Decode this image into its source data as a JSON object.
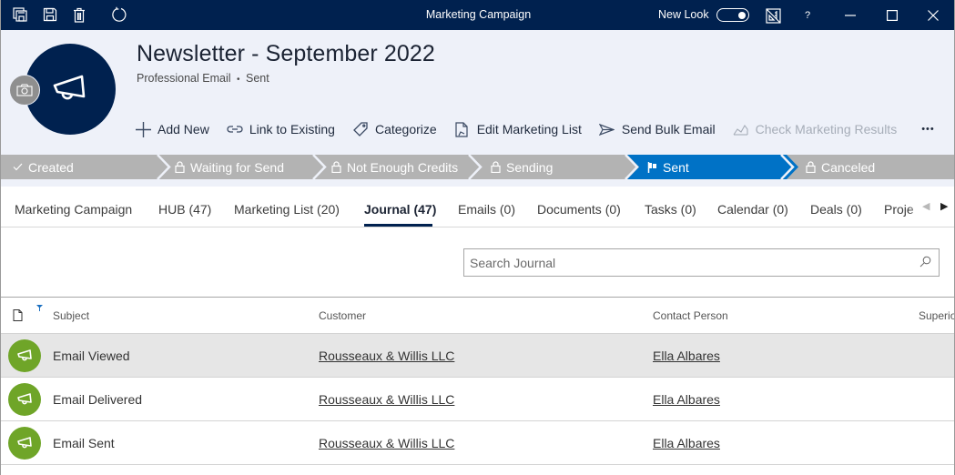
{
  "window": {
    "title": "Marketing Campaign",
    "new_look_label": "New Look",
    "new_look_on": true,
    "help_label": "?"
  },
  "titlebar_icons": [
    "save-all-icon",
    "save-icon",
    "delete-icon",
    "refresh-icon"
  ],
  "record": {
    "title": "Newsletter - September 2022",
    "subtitle_type": "Professional Email",
    "subtitle_sep": "•",
    "subtitle_status": "Sent"
  },
  "commands": [
    {
      "label": "Add New",
      "icon": "plus-icon",
      "enabled": true
    },
    {
      "label": "Link to Existing",
      "icon": "link-icon",
      "enabled": true
    },
    {
      "label": "Categorize",
      "icon": "tag-icon",
      "enabled": true
    },
    {
      "label": "Edit Marketing List",
      "icon": "edit-list-icon",
      "enabled": true
    },
    {
      "label": "Send Bulk Email",
      "icon": "send-icon",
      "enabled": true
    },
    {
      "label": "Check Marketing Results",
      "icon": "chart-icon",
      "enabled": false
    },
    {
      "label": "•••",
      "icon": "more-icon",
      "enabled": true
    }
  ],
  "stages": [
    {
      "label": "Created",
      "icon": "check-icon",
      "state": "done"
    },
    {
      "label": "Waiting for Send",
      "icon": "lock-icon",
      "state": "locked"
    },
    {
      "label": "Not Enough Credits",
      "icon": "lock-icon",
      "state": "locked"
    },
    {
      "label": "Sending",
      "icon": "lock-icon",
      "state": "locked"
    },
    {
      "label": "Sent",
      "icon": "flag-icon",
      "state": "active"
    },
    {
      "label": "Canceled",
      "icon": "lock-icon",
      "state": "locked"
    }
  ],
  "tabs": [
    {
      "label": "Marketing Campaign",
      "active": false
    },
    {
      "label": "HUB (47)",
      "active": false
    },
    {
      "label": "Marketing List (20)",
      "active": false
    },
    {
      "label": "Journal (47)",
      "active": true
    },
    {
      "label": "Emails (0)",
      "active": false
    },
    {
      "label": "Documents (0)",
      "active": false
    },
    {
      "label": "Tasks (0)",
      "active": false
    },
    {
      "label": "Calendar (0)",
      "active": false
    },
    {
      "label": "Deals (0)",
      "active": false
    },
    {
      "label": "Proje",
      "active": false
    }
  ],
  "search": {
    "placeholder": "Search Journal",
    "value": ""
  },
  "grid": {
    "columns": [
      "Subject",
      "Customer",
      "Contact Person",
      "Superio"
    ],
    "rows": [
      {
        "subject": "Email Viewed",
        "customer": "Rousseaux & Willis LLC",
        "contact": "Ella Albares",
        "selected": true
      },
      {
        "subject": "Email Delivered",
        "customer": "Rousseaux & Willis LLC",
        "contact": "Ella Albares",
        "selected": false
      },
      {
        "subject": "Email Sent",
        "customer": "Rousseaux & Willis LLC",
        "contact": "Ella Albares",
        "selected": false
      }
    ]
  },
  "colors": {
    "titlebar": "#00214f",
    "header_bg": "#eef1f9",
    "stage_inactive": "#b3b3b3",
    "stage_active": "#0072c6",
    "journal_icon": "#6fa528",
    "row_selected": "#e6e6e6"
  }
}
